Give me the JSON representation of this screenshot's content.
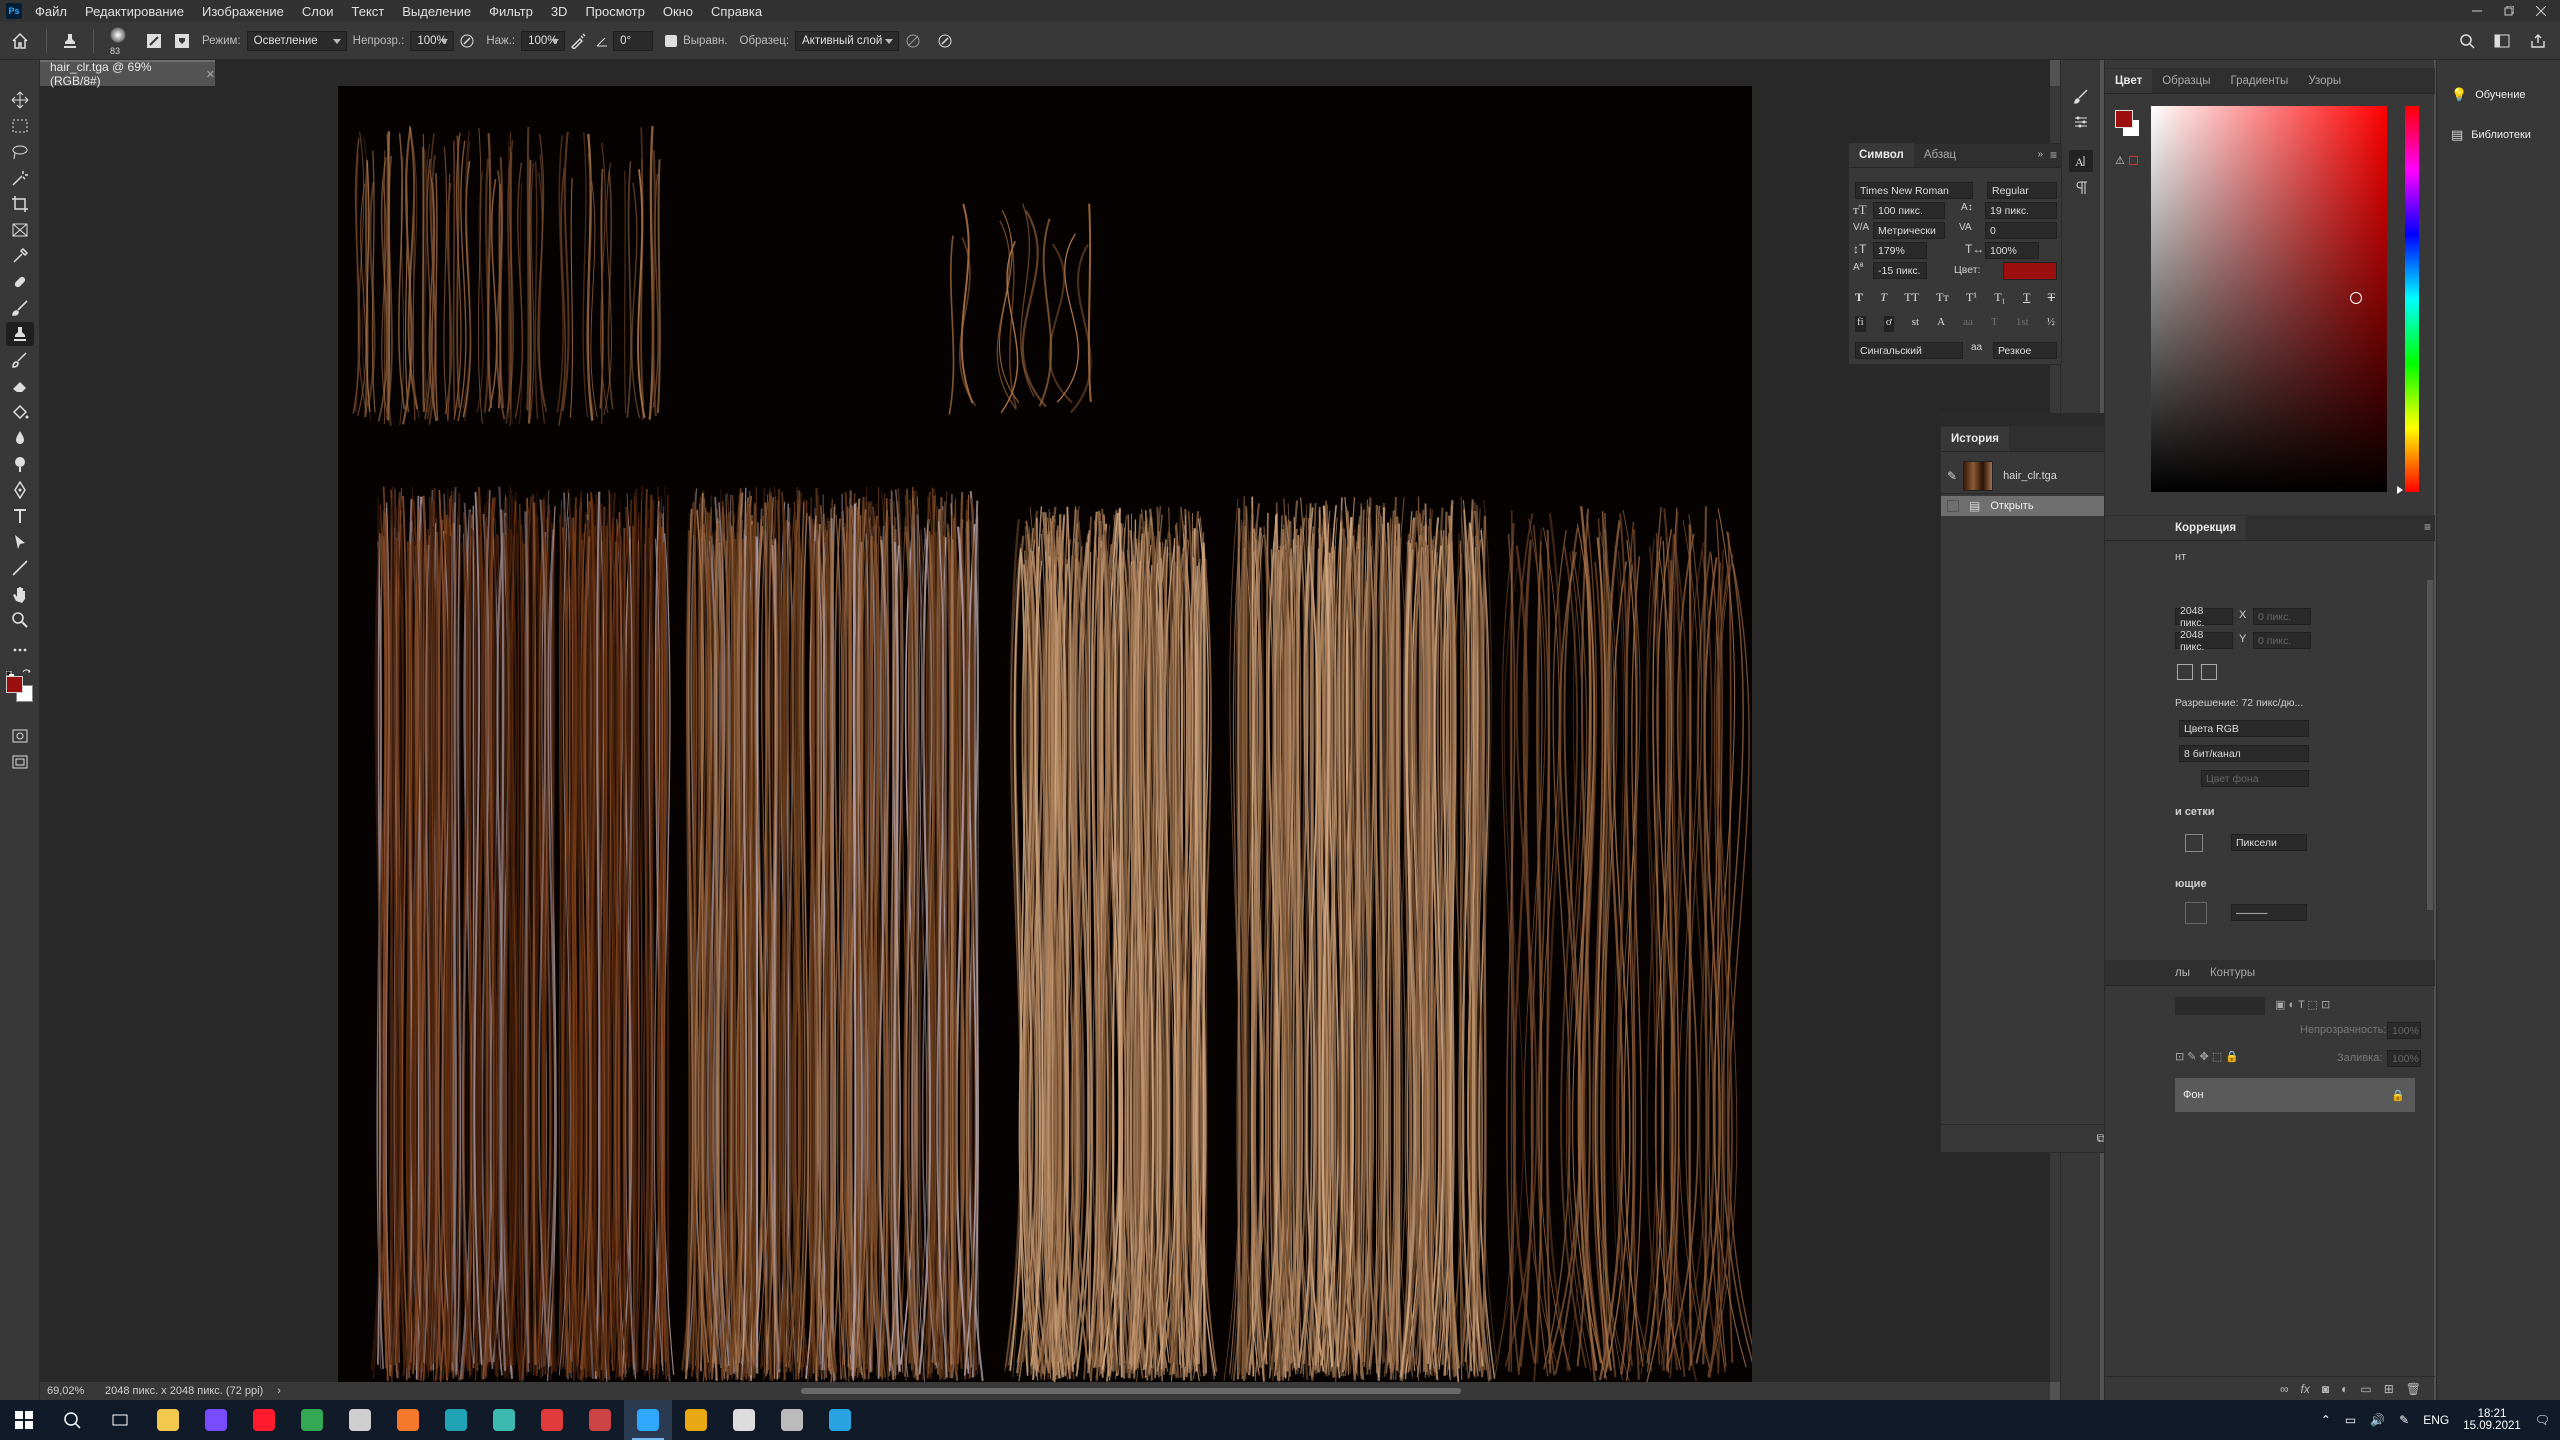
{
  "menubar": {
    "items": [
      "Файл",
      "Редактирование",
      "Изображение",
      "Слои",
      "Текст",
      "Выделение",
      "Фильтр",
      "3D",
      "Просмотр",
      "Окно",
      "Справка"
    ]
  },
  "options": {
    "brush_size": "83",
    "mode_label": "Режим:",
    "mode_value": "Осветление",
    "opacity_label": "Непрозр.:",
    "opacity_value": "100%",
    "pressure_label": "Наж.:",
    "pressure_value": "100%",
    "angle_value": "0°",
    "align_label": "Выравн.",
    "sample_label": "Образец:",
    "sample_value": "Активный слой"
  },
  "document": {
    "tab_title": "hair_clr.tga @ 69% (RGB/8#)",
    "background": "#060201"
  },
  "status": {
    "zoom": "69,02%",
    "info": "2048 пикс. x 2048 пикс. (72 ppi)"
  },
  "character_panel": {
    "tabs": [
      "Символ",
      "Абзац"
    ],
    "font_family": "Times New Roman",
    "font_style": "Regular",
    "font_size": "100 пикс.",
    "leading": "19 пикс.",
    "kerning": "Метрически",
    "tracking": "0",
    "vscale": "179%",
    "hscale": "100%",
    "baseline": "-15 пикс.",
    "color_label": "Цвет:",
    "color": "#9b0f0f",
    "language": "Сингальский",
    "antialias": "Резкое"
  },
  "history_panel": {
    "title": "История",
    "snapshot": "hair_clr.tga",
    "steps": [
      "Открыть"
    ]
  },
  "color_panel": {
    "tabs": [
      "Цвет",
      "Образцы",
      "Градиенты",
      "Узоры"
    ],
    "foreground": "#9b0f0f",
    "background": "#ffffff"
  },
  "learn_panel": {
    "items": [
      "Обучение",
      "Библиотеки"
    ]
  },
  "properties_panel": {
    "tab": "Коррекция",
    "tab_partial": "нт",
    "width": "2048 пикс.",
    "height": "2048 пикс.",
    "x_label": "X",
    "y_label": "Y",
    "x_placeholder": "0 пикс.",
    "y_placeholder": "0 пикс.",
    "resolution": "Разрешение: 72 пикс/дю...",
    "mode": "Цвета RGB",
    "depth": "8 бит/канал",
    "bg_color": "Цвет фона",
    "grid_section": "и сетки",
    "grid_unit": "Пиксели",
    "guides_section": "ющие"
  },
  "layers_panel": {
    "tabs": [
      "лы",
      "Контуры"
    ],
    "opacity_label": "Непрозрачность:",
    "opacity_value": "100%",
    "fill_label": "Заливка:",
    "fill_value": "100%",
    "layer_name": "Фон"
  },
  "taskbar": {
    "lang": "ENG",
    "time": "18:21",
    "date": "15.09.2021",
    "apps": [
      {
        "name": "file-explorer",
        "color": "#f2c94c"
      },
      {
        "name": "app-purple",
        "color": "#7a4cff"
      },
      {
        "name": "opera",
        "color": "#ff1b2d"
      },
      {
        "name": "chrome",
        "color": "#34a853"
      },
      {
        "name": "app-gallery",
        "color": "#cfcfcf"
      },
      {
        "name": "blender",
        "color": "#f5792a"
      },
      {
        "name": "app-teal",
        "color": "#1fa3b5"
      },
      {
        "name": "maya",
        "color": "#3dbab0"
      },
      {
        "name": "substance",
        "color": "#e23b3b"
      },
      {
        "name": "davinci",
        "color": "#c44"
      },
      {
        "name": "photoshop",
        "color": "#31a8ff"
      },
      {
        "name": "app-yellow",
        "color": "#e7a813"
      },
      {
        "name": "unreal",
        "color": "#dddddd"
      },
      {
        "name": "unity",
        "color": "#bbbbbb"
      },
      {
        "name": "telegram",
        "color": "#2aa3e0"
      }
    ]
  }
}
